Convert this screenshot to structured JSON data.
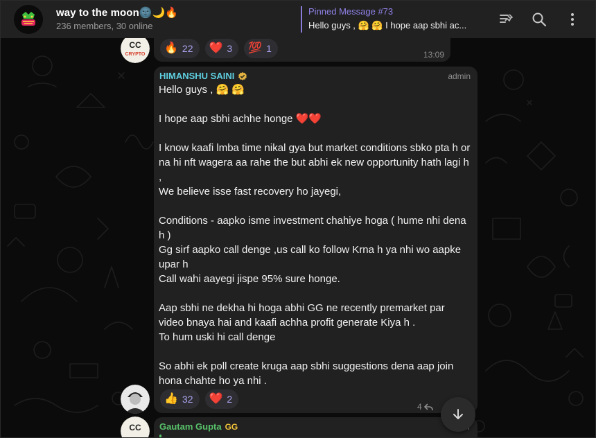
{
  "header": {
    "title": "way to the moon🌚🌙🔥",
    "subtitle": "236 members, 30 online",
    "pinned_label": "Pinned Message #73",
    "pinned_preview": "Hello guys , 🤗 🤗 I hope aap sbhi ac..."
  },
  "messages": [
    {
      "avatar_text": "CC",
      "avatar_sub": "CRYPTO",
      "reactions": [
        {
          "emoji": "🔥",
          "count": "22"
        },
        {
          "emoji": "❤️",
          "count": "3"
        },
        {
          "emoji": "💯",
          "count": "1"
        }
      ],
      "time": "13:09"
    },
    {
      "sender": "HIMANSHU SAINI",
      "role": "admin",
      "paragraphs": [
        "Hello guys , 🤗 🤗",
        "",
        "I hope aap sbhi achhe honge ❤️❤️",
        "",
        "I know kaafi lmba time nikal gya but market conditions sbko pta h or na hi nft wagera aa rahe the but abhi ek new opportunity hath lagi h ,",
        "We believe isse fast recovery ho jayegi,",
        "",
        "Conditions - aapko isme investment chahiye hoga ( hume nhi dena h )",
        "Gg sirf aapko call denge ,us call ko follow Krna h ya nhi wo aapke upar h",
        "Call wahi aayegi jispe 95% sure honge.",
        "",
        "Aap sbhi ne dekha hi hoga abhi GG ne recently premarket par video bnaya hai and kaafi achha profit generate Kiya h .",
        "To hum uski hi call denge",
        "",
        "So abhi ek poll create kruga aap sbhi suggestions dena aap join hona chahte ho ya nhi ."
      ],
      "reactions": [
        {
          "emoji": "👍",
          "count": "32"
        },
        {
          "emoji": "❤️",
          "count": "2"
        }
      ],
      "replies": "4"
    },
    {
      "sender": "Gautam Gupta",
      "sender_badge": "GG",
      "role_partial": "er",
      "avatar_text": "CC"
    }
  ],
  "colors": {
    "accent": "#8f82e8",
    "sender_cyan": "#5fd0e0",
    "bubble": "#212121",
    "header": "#212121"
  },
  "icons": [
    "pin-list-icon",
    "search-icon",
    "more-vert-icon",
    "scroll-down-arrow-icon",
    "verified-badge-icon",
    "reply-arrow-icon"
  ]
}
